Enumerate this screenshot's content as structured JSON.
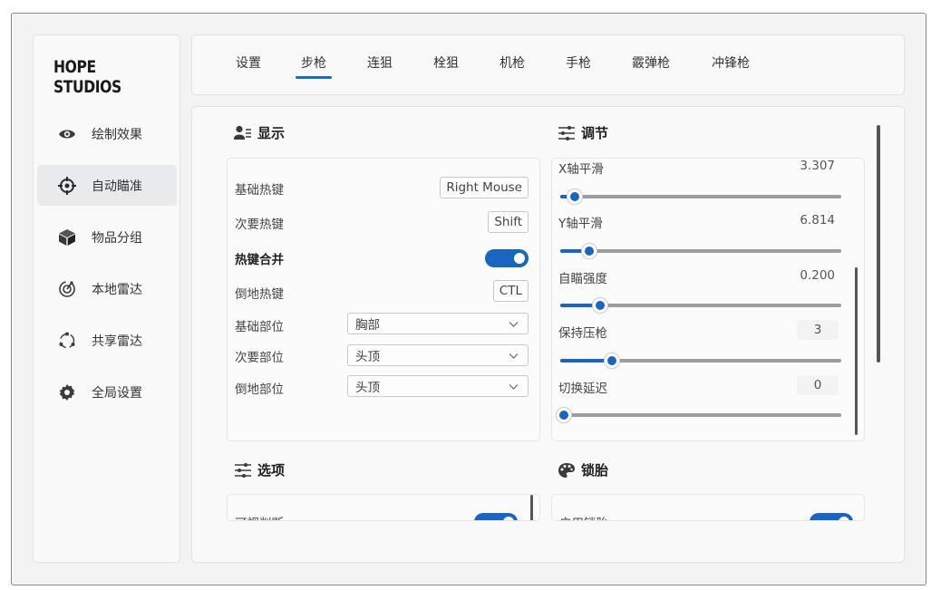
{
  "brand": "HOPE STUDIOS",
  "sidebar": {
    "items": [
      {
        "label": "绘制效果",
        "icon": "eye-icon",
        "active": false
      },
      {
        "label": "自动瞄准",
        "icon": "crosshair-icon",
        "active": true
      },
      {
        "label": "物品分组",
        "icon": "cube-icon",
        "active": false
      },
      {
        "label": "本地雷达",
        "icon": "radar-icon",
        "active": false
      },
      {
        "label": "共享雷达",
        "icon": "share-nodes-icon",
        "active": false
      },
      {
        "label": "全局设置",
        "icon": "gear-icon",
        "active": false
      }
    ]
  },
  "tabs": [
    {
      "label": "设置",
      "active": false
    },
    {
      "label": "步枪",
      "active": true
    },
    {
      "label": "连狙",
      "active": false
    },
    {
      "label": "栓狙",
      "active": false
    },
    {
      "label": "机枪",
      "active": false
    },
    {
      "label": "手枪",
      "active": false
    },
    {
      "label": "霰弹枪",
      "active": false
    },
    {
      "label": "冲锋枪",
      "active": false
    }
  ],
  "display": {
    "title": "显示",
    "basic_hotkey_label": "基础热键",
    "basic_hotkey_value": "Right Mouse",
    "secondary_hotkey_label": "次要热键",
    "secondary_hotkey_value": "Shift",
    "merge_hotkey_label": "热键合并",
    "merge_hotkey_on": true,
    "down_hotkey_label": "倒地热键",
    "down_hotkey_value": "CTL",
    "basic_part_label": "基础部位",
    "basic_part_value": "胸部",
    "secondary_part_label": "次要部位",
    "secondary_part_value": "头顶",
    "down_part_label": "倒地部位",
    "down_part_value": "头顶"
  },
  "adjust": {
    "title": "调节",
    "sliders": [
      {
        "label": "X轴平滑",
        "value": "3.307",
        "fraction": 0.04
      },
      {
        "label": "Y轴平滑",
        "value": "6.814",
        "fraction": 0.09
      },
      {
        "label": "自瞄强度",
        "value": "0.200",
        "fraction": 0.13
      },
      {
        "label": "保持压枪",
        "value": "3",
        "fraction": 0.17
      },
      {
        "label": "切换延迟",
        "value": "0",
        "fraction": 0.0
      }
    ]
  },
  "options": {
    "title": "选项",
    "first_label": "可视判断",
    "first_on": true
  },
  "lock": {
    "title": "锁胎",
    "first_label": "启用锁胎",
    "first_on": true
  },
  "colors": {
    "accent": "#1a65bf",
    "track": "#9d9d9d"
  }
}
